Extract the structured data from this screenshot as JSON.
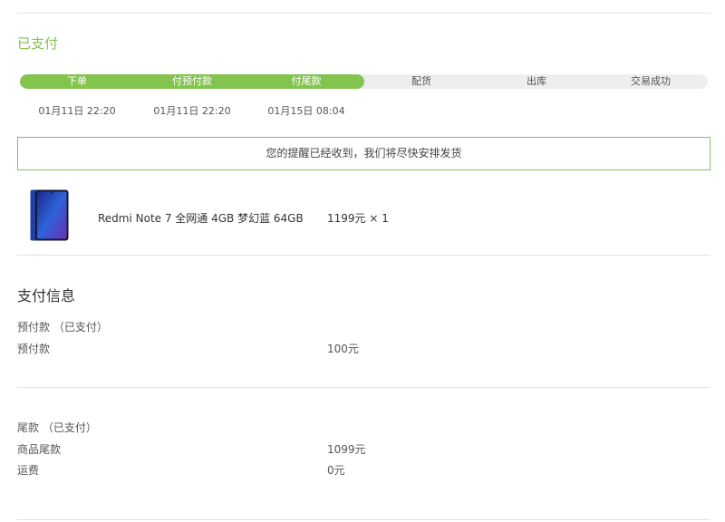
{
  "order": {
    "status": "已支付"
  },
  "progress": {
    "steps": [
      {
        "label": "下单",
        "done": true
      },
      {
        "label": "付预付款",
        "done": true
      },
      {
        "label": "付尾款",
        "done": true
      },
      {
        "label": "配货",
        "done": false
      },
      {
        "label": "出库",
        "done": false
      },
      {
        "label": "交易成功",
        "done": false
      }
    ],
    "times": [
      "01月11日 22:20",
      "01月11日 22:20",
      "01月15日 08:04"
    ],
    "fill_color": "#83c44e"
  },
  "notice": {
    "text": "您的提醒已经收到，我们将尽快安排发货"
  },
  "product": {
    "name": "Redmi Note 7 全网通 4GB 梦幻蓝 64GB",
    "price_qty": "1199元 × 1",
    "icon": "phone-image"
  },
  "payment": {
    "title": "支付信息",
    "deposit": {
      "heading": "预付款 （已支付）",
      "rows": [
        {
          "label": "预付款",
          "value": "100元"
        }
      ]
    },
    "balance": {
      "heading": "尾款 （已支付）",
      "rows": [
        {
          "label": "商品尾款",
          "value": "1099元"
        },
        {
          "label": "运费",
          "value": "0元"
        }
      ]
    }
  }
}
